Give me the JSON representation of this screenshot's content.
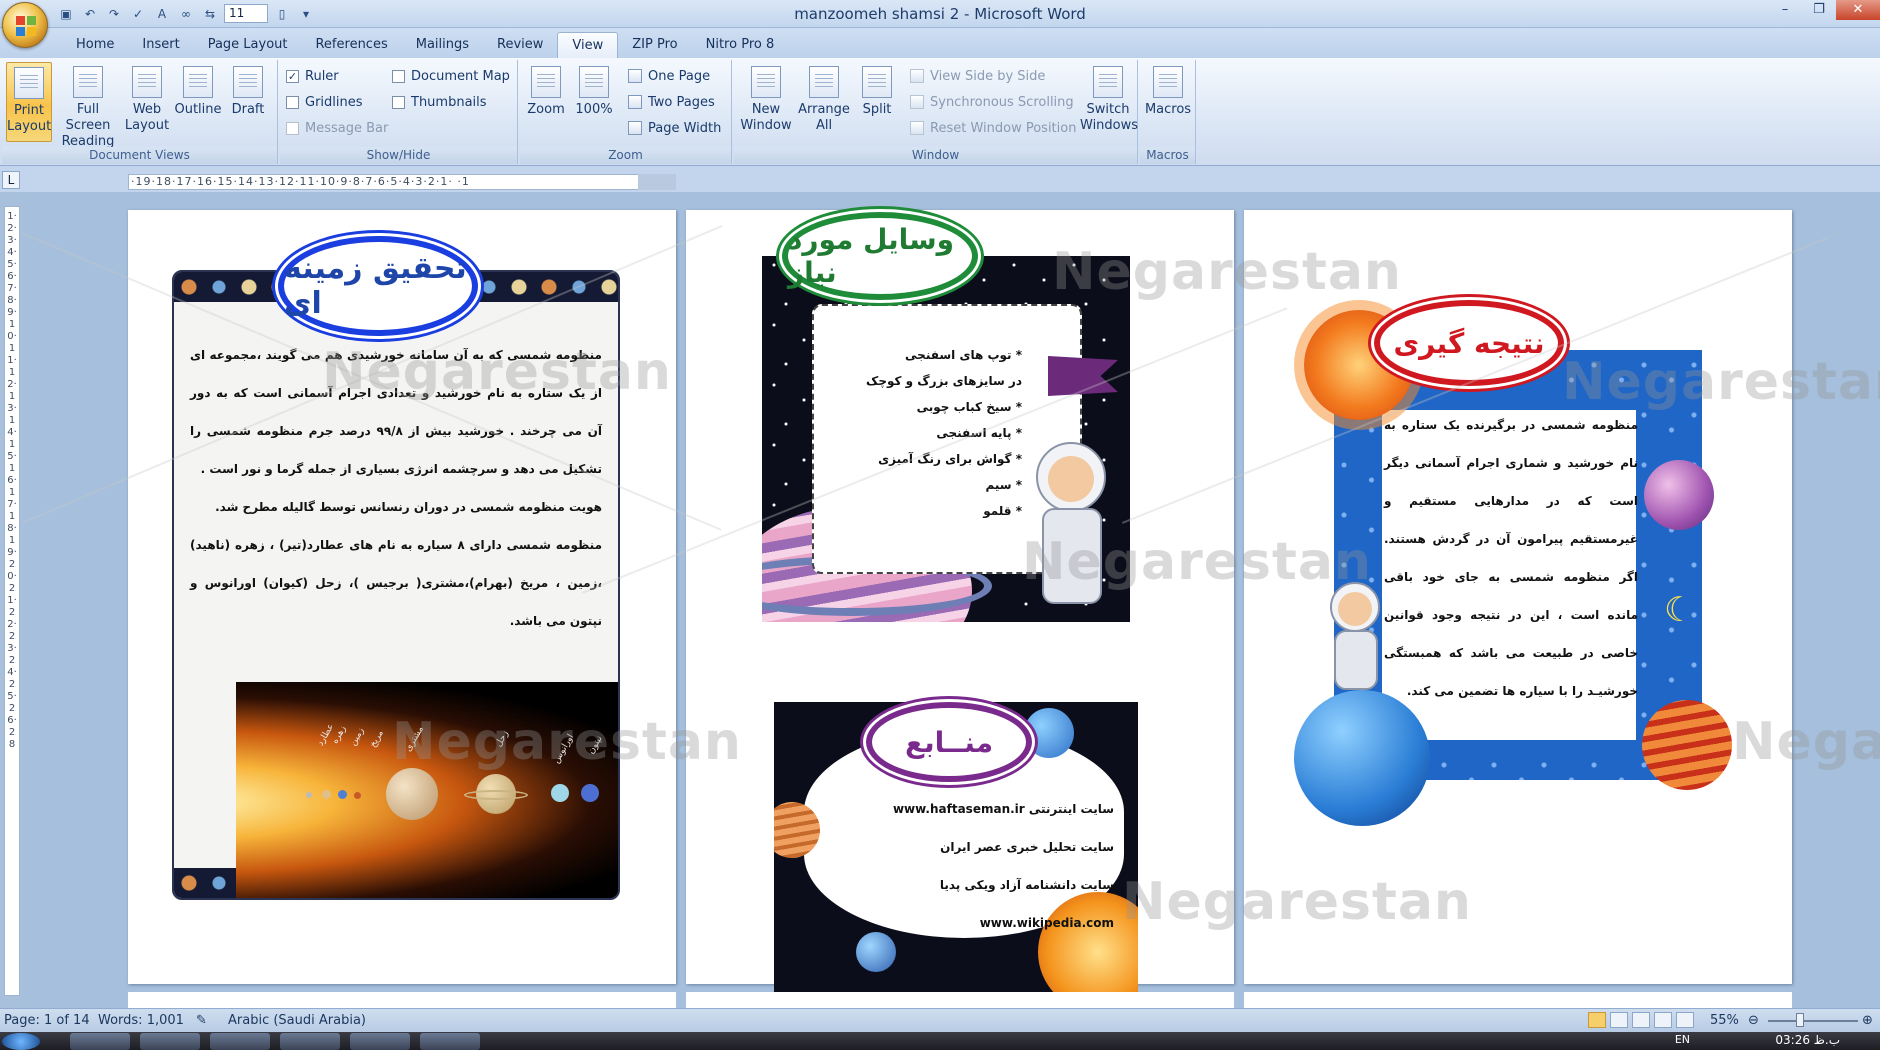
{
  "window": {
    "title": "manzoomeh shamsi 2 - Microsoft Word",
    "font_size_value": "11"
  },
  "tabs": [
    "Home",
    "Insert",
    "Page Layout",
    "References",
    "Mailings",
    "Review",
    "View",
    "ZIP Pro",
    "Nitro Pro 8"
  ],
  "active_tab": "View",
  "ribbon": {
    "document_views": {
      "label": "Document Views",
      "print_layout": "Print Layout",
      "full_screen_reading": "Full Screen Reading",
      "web_layout": "Web Layout",
      "outline": "Outline",
      "draft": "Draft"
    },
    "show_hide": {
      "label": "Show/Hide",
      "ruler": "Ruler",
      "gridlines": "Gridlines",
      "message_bar": "Message Bar",
      "document_map": "Document Map",
      "thumbnails": "Thumbnails",
      "ruler_checked": true
    },
    "zoom": {
      "label": "Zoom",
      "zoom": "Zoom",
      "hundred": "100%",
      "one_page": "One Page",
      "two_pages": "Two Pages",
      "page_width": "Page Width"
    },
    "window": {
      "label": "Window",
      "new_window": "New Window",
      "arrange_all": "Arrange All",
      "split": "Split",
      "view_side_by_side": "View Side by Side",
      "synchronous_scrolling": "Synchronous Scrolling",
      "reset_window_position": "Reset Window Position",
      "switch_windows": "Switch Windows"
    },
    "macros": {
      "label": "Macros",
      "macros": "Macros"
    }
  },
  "ruler": {
    "horizontal": "·19·18·17·16·15·14·13·12·11·10·9·8·7·6·5·4·3·2·1·   ·1",
    "vertical": "1·2·3·4·5·6·7·8·9·10·11·12·13·14·15·16·17·18·19·20·21·22·23·24·25·26·28"
  },
  "pages": {
    "p1": {
      "heading": "تحقیق زمینه ای",
      "paragraphs": [
        "منظومه شمسی که به آن سامانه خورشیدی هم می گویند ،مجموعه ای از یک ستاره به نام خورشید و تعدادی اجرام آسمانی است که به دور آن می چرخند . خورشید بیش از ۹۹/۸ درصد جرم منظومه شمسی را تشکیل می دهد و سرچشمه انرژی بسیاری از جمله گرما و نور است .",
        "هویت منظومه شمسی در دوران رنسانس توسط گالیله مطرح شد.",
        "منظومه شمسی دارای ۸ سیاره به نام های عطارد(تیر) ، زهره (ناهید) ،زمین ، مریخ (بهرام)،مشتری( برجیس )، زحل (کیوان) اورانوس و نپتون می باشد."
      ],
      "planet_labels": [
        "عطارد",
        "زهره",
        "زمین",
        "مریخ",
        "مشتری",
        "زحل",
        "اورانوس",
        "نپتون"
      ]
    },
    "p2": {
      "heading_tools": "وسایل مورد نیاز",
      "tools": [
        "* توپ های اسفنجی",
        "در سایزهای بزرگ و کوچک",
        "* سیخ کباب چوبی",
        "* پایه اسفنجی",
        "* گواش برای رنگ آمیزی",
        "* سیم",
        "* قلمو"
      ],
      "heading_refs": "منــابع",
      "refs": [
        "سایت اینترنتی www.haftaseman.ir",
        "سایت تحلیل خبری عصر ایران",
        "سایت دانشنامه آزاد ویکی پدیا www.wikipedia.com"
      ]
    },
    "p3": {
      "heading": "نتیجه گیری",
      "text": "منظومه شمسی در برگیرنده یک ستاره به نام خورشید و شماری اجرام آسمانی دیگر است که در مدارهایی مستقیم و غیرمستقیم پیرامون آن در گردش هستند. اگر منظومه شمسی به جای خود باقی مانده است ، این در نتیجه وجود قوانین خاصی در طبیعت می باشد که همبستگی خورشیـد را با سیاره ها تضمین می کند."
    }
  },
  "watermark": "Negarestan",
  "status": {
    "page": "Page: 1 of 14",
    "words": "Words: 1,001",
    "language": "Arabic (Saudi Arabia)",
    "zoom": "55%"
  },
  "taskbar": {
    "lang": "EN",
    "clock": "03:26 ب.ظ"
  },
  "colors": {
    "ribbon_accent": "#f8c34a",
    "heading_blue": "#1a3ee0",
    "heading_green": "#1f8c3a",
    "heading_purple": "#7a2a8c",
    "heading_red": "#d01820"
  }
}
